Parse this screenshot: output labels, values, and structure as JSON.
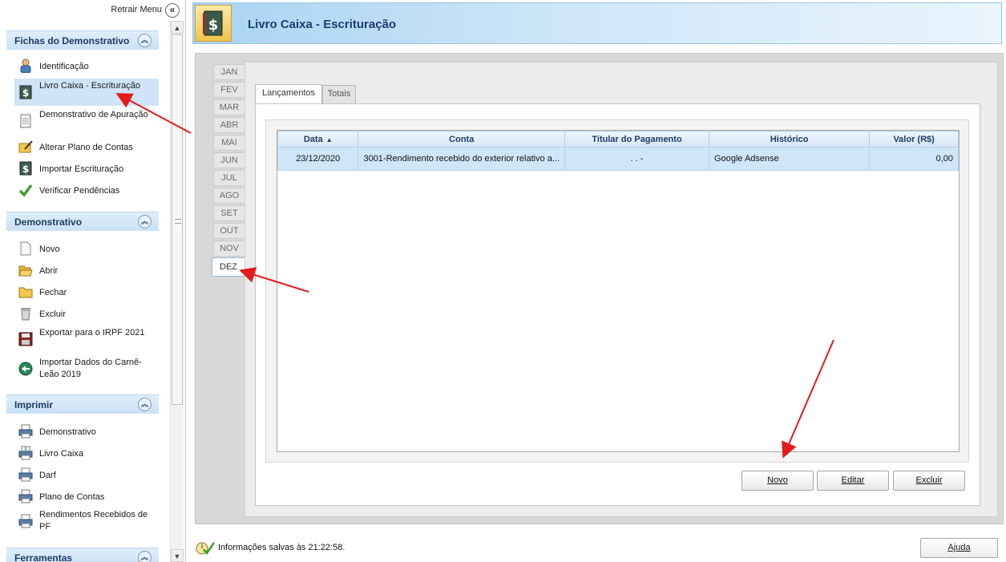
{
  "sidebar": {
    "retrair_label": "Retrair Menu",
    "sections": {
      "fichas": {
        "title": "Fichas do Demonstrativo",
        "items": [
          "Identificação",
          "Livro Caixa - Escrituração",
          "Demonstrativo de Apuração",
          "Alterar Plano de Contas",
          "Importar Escrituração",
          "Verificar Pendências"
        ]
      },
      "demonstrativo": {
        "title": "Demonstrativo",
        "items": [
          "Novo",
          "Abrir",
          "Fechar",
          "Excluir",
          "Exportar para o IRPF 2021",
          "Importar Dados do Carnê-Leão 2019"
        ]
      },
      "imprimir": {
        "title": "Imprimir",
        "items": [
          "Demonstrativo",
          "Livro Caixa",
          "Darf",
          "Plano de Contas",
          "Rendimentos Recebidos de PF"
        ]
      },
      "ferramentas": {
        "title": "Ferramentas"
      }
    }
  },
  "header": {
    "title": "Livro Caixa - Escrituração"
  },
  "months": [
    "JAN",
    "FEV",
    "MAR",
    "ABR",
    "MAI",
    "JUN",
    "JUL",
    "AGO",
    "SET",
    "OUT",
    "NOV",
    "DEZ"
  ],
  "active_month": "DEZ",
  "tabs": [
    "Lançamentos",
    "Totais"
  ],
  "table": {
    "columns": [
      "Data",
      "Conta",
      "Titular do Pagamento",
      "Histórico",
      "Valor (R$)"
    ],
    "rows": [
      [
        "23/12/2020",
        "3001-Rendimento recebido do exterior relativo a...",
        ". . -",
        "Google Adsense",
        "0,00"
      ]
    ]
  },
  "buttons": {
    "novo": "Novo",
    "editar": "Editar",
    "excluir": "Excluir",
    "ajuda": "Ajuda"
  },
  "status": {
    "text": "Informações salvas às 21:22:58."
  },
  "colors": {
    "accent": "#1c3d6e",
    "selection": "#cfe6f8",
    "annotation_arrow": "#e31b1b"
  }
}
